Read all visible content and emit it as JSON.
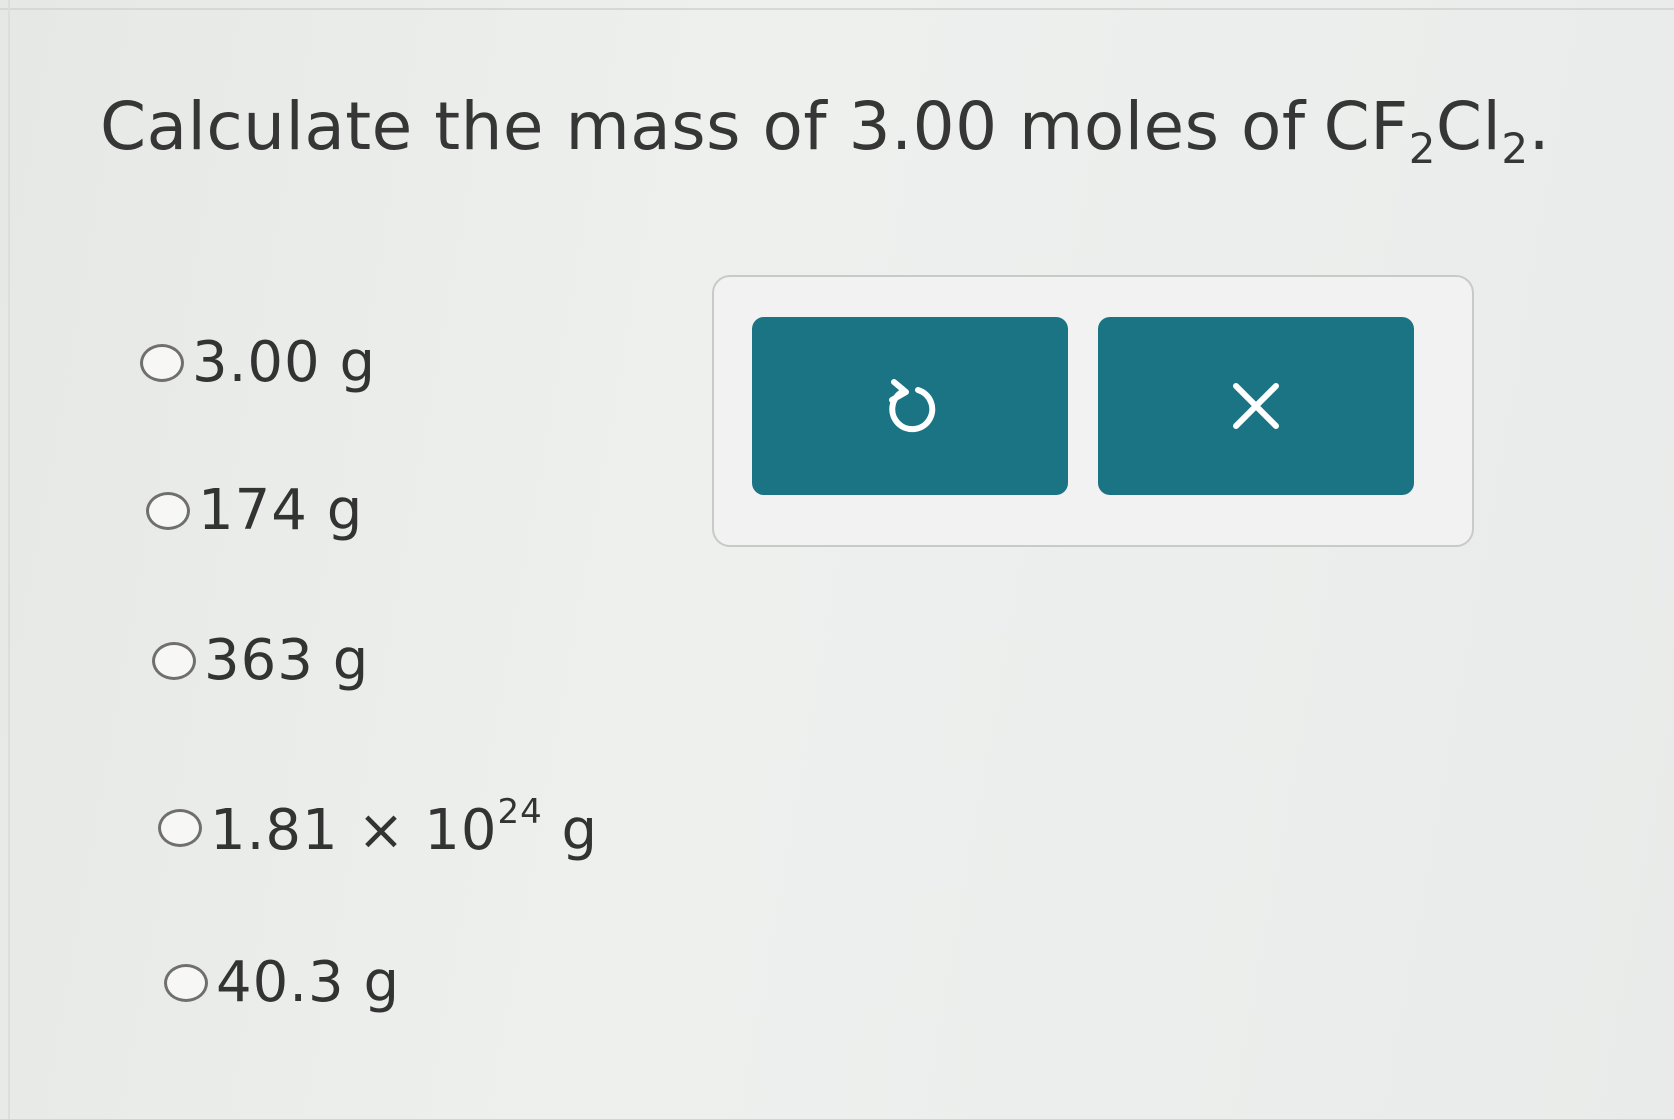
{
  "question": {
    "prefix": "Calculate the mass of 3.00 moles of",
    "formula": {
      "el1": "CF",
      "sub1": "2",
      "el2": "Cl",
      "sub2": "2",
      "end": "."
    }
  },
  "choices": [
    {
      "label": "3.00 g"
    },
    {
      "label": "174 g"
    },
    {
      "label": "363 g"
    },
    {
      "label_base": "1.81 × 10",
      "label_exp": "24",
      "label_unit": " g"
    },
    {
      "label": "40.3 g"
    }
  ],
  "toolbar": {
    "reset_icon": "undo-icon",
    "clear_icon": "close-icon"
  },
  "colors": {
    "button": "#1a7484",
    "background": "#eceeed",
    "text": "#363636"
  }
}
